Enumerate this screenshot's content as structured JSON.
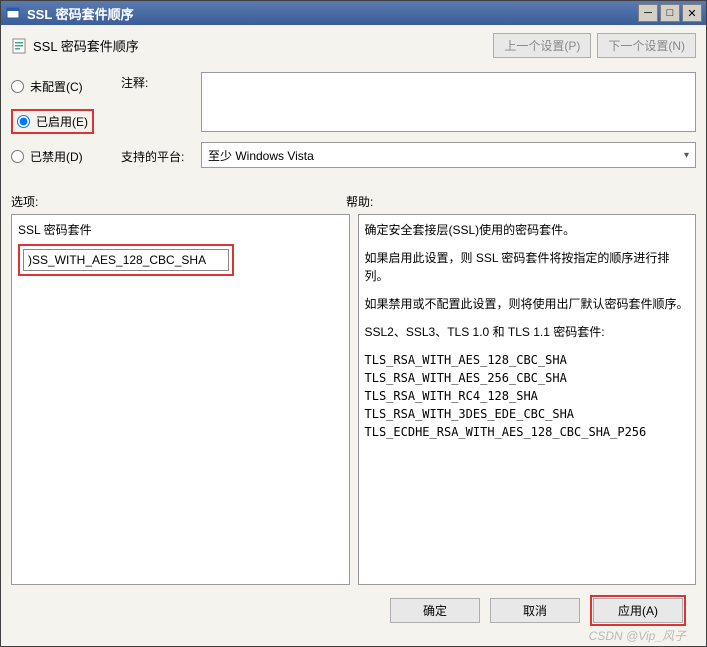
{
  "window": {
    "title": "SSL 密码套件顺序"
  },
  "header": {
    "label": "SSL 密码套件顺序",
    "prev_btn": "上一个设置(P)",
    "next_btn": "下一个设置(N)"
  },
  "config": {
    "not_configured": "未配置(C)",
    "enabled": "已启用(E)",
    "disabled": "已禁用(D)",
    "comment_label": "注释:",
    "comment_value": "",
    "platform_label": "支持的平台:",
    "platform_value": "至少 Windows Vista"
  },
  "options": {
    "label": "选项:",
    "panel_title": "SSL 密码套件",
    "cipher_value": ")SS_WITH_AES_128_CBC_SHA"
  },
  "help": {
    "label": "帮助:",
    "p1": "确定安全套接层(SSL)使用的密码套件。",
    "p2": "如果启用此设置，则 SSL 密码套件将按指定的顺序进行排列。",
    "p3": "如果禁用或不配置此设置，则将使用出厂默认密码套件顺序。",
    "p4": "SSL2、SSL3、TLS 1.0 和 TLS 1.1 密码套件:",
    "c1": "TLS_RSA_WITH_AES_128_CBC_SHA",
    "c2": "TLS_RSA_WITH_AES_256_CBC_SHA",
    "c3": "TLS_RSA_WITH_RC4_128_SHA",
    "c4": "TLS_RSA_WITH_3DES_EDE_CBC_SHA",
    "c5": "TLS_ECDHE_RSA_WITH_AES_128_CBC_SHA_P256"
  },
  "footer": {
    "ok": "确定",
    "cancel": "取消",
    "apply": "应用(A)"
  },
  "watermark": "CSDN @Vip_风子"
}
